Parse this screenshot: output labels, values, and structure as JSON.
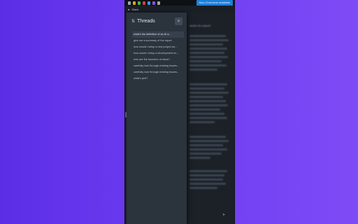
{
  "notice": {
    "text": "New Chromium available"
  },
  "tab": {
    "title": "Slack"
  },
  "chat": {
    "question": "what's its output?"
  },
  "panel": {
    "title": "Threads",
    "close_label": "×",
    "threads": [
      "what's the definition of an AI a...",
      "give me a summary of the report",
      "how would i setup a new project an...",
      "how would i setup a development en...",
      "who are the founders of slack?",
      "carefully look through existing issues...",
      "carefully look through existing issues...",
      "what's perf?"
    ]
  },
  "colors": {
    "accent": "#1e7fd8",
    "panel_bg": "#2b333d",
    "window_bg": "#1c2128"
  }
}
